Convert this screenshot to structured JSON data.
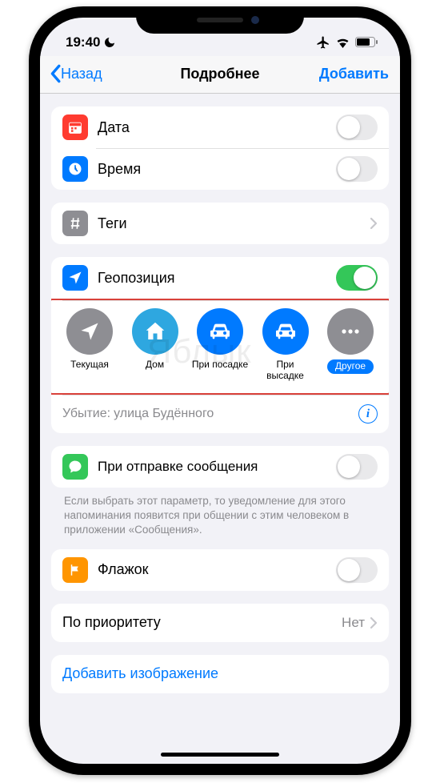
{
  "status": {
    "time": "19:40"
  },
  "nav": {
    "back": "Назад",
    "title": "Подробнее",
    "add": "Добавить"
  },
  "rows": {
    "date": "Дата",
    "time": "Время",
    "tags": "Теги",
    "geo": "Геопозиция",
    "departure_key": "Убытие:",
    "departure_val": "улица Будённого",
    "on_message": "При отправке сообщения",
    "flag": "Флажок",
    "priority": "По приоритету",
    "priority_val": "Нет",
    "add_image": "Добавить изображение"
  },
  "loc": {
    "current": "Текущая",
    "home": "Дом",
    "boarding": "При посадке",
    "dropoff": "При высадке",
    "other": "Другое"
  },
  "footnote": "Если выбрать этот параметр, то уведомление для этого напоминания появится при общении с этим человеком в приложении «Сообщения».",
  "watermark": "Яблык"
}
